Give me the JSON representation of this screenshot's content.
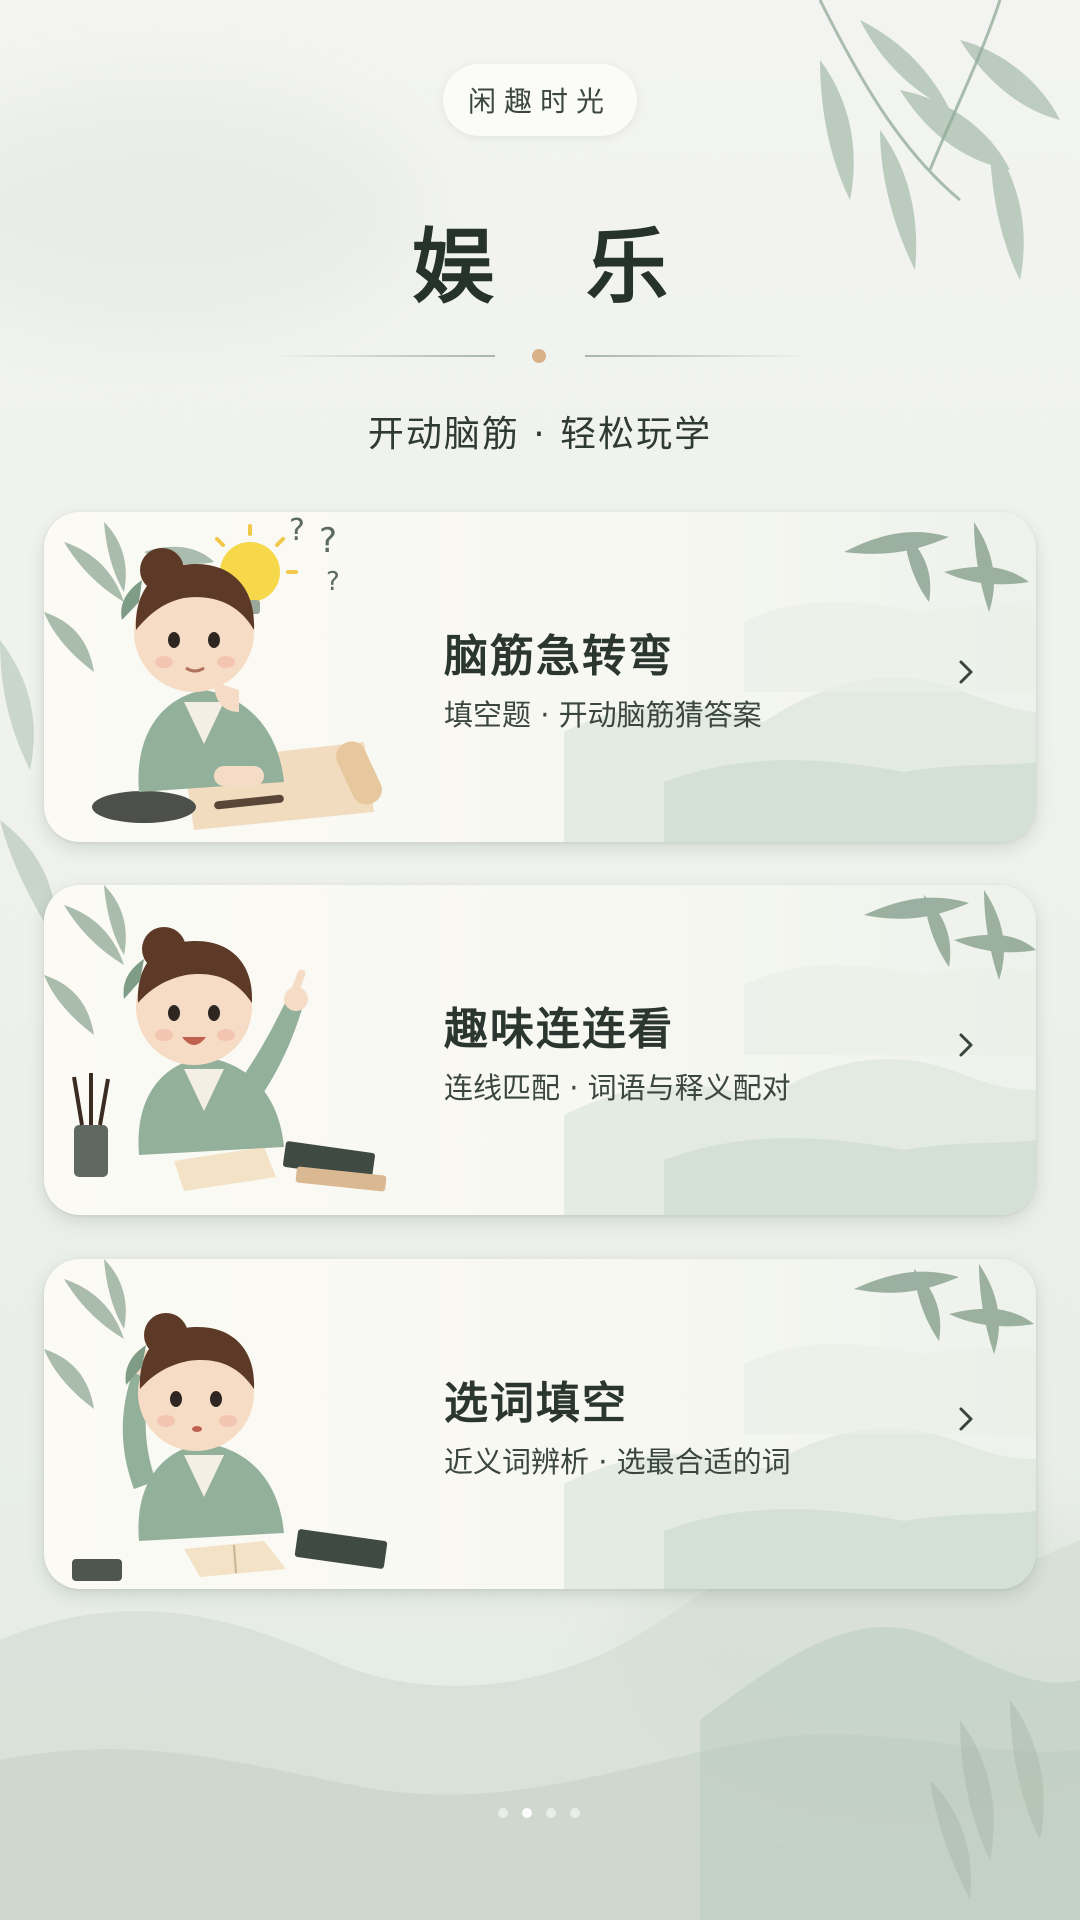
{
  "header": {
    "badge": "闲趣时光",
    "title": "娱乐",
    "subtitle": "开动脑筋 · 轻松玩学"
  },
  "cards": [
    {
      "title": "脑筋急转弯",
      "description": "填空题 · 开动脑筋猜答案",
      "illustration": "child-thinking-with-lightbulb"
    },
    {
      "title": "趣味连连看",
      "description": "连线匹配 · 词语与释义配对",
      "illustration": "child-pointing-with-books"
    },
    {
      "title": "选词填空",
      "description": "近义词辨析 · 选最合适的词",
      "illustration": "child-scratching-head-with-book"
    }
  ],
  "icons": {
    "card_arrow": "chevron-right-icon"
  },
  "colors": {
    "background": "#eef1ec",
    "card": "#f9f9f4",
    "accent_dot": "#d9b28a",
    "text": "#2b3630",
    "ink_green": "#7f9a86"
  }
}
